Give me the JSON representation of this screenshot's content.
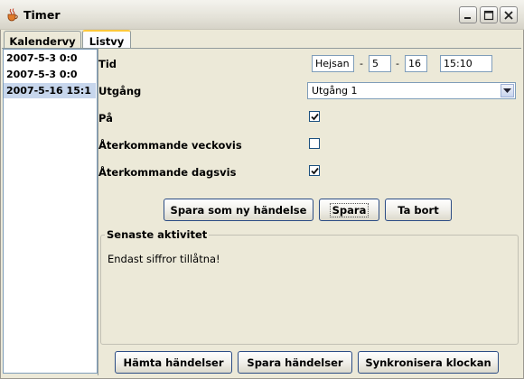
{
  "window": {
    "title": "Timer"
  },
  "tabs": [
    {
      "label": "Kalendervy",
      "active": false
    },
    {
      "label": "Listvy",
      "active": true
    }
  ],
  "event_list": {
    "items": [
      "2007-5-3 0:0",
      "2007-5-3 0:0",
      "2007-5-16 15:1"
    ],
    "selected_index": 2
  },
  "form": {
    "time": {
      "label": "Tid",
      "title_value": "Hejsan",
      "month": "5",
      "day": "16",
      "clock": "15:10",
      "separator": "-"
    },
    "output": {
      "label": "Utgång",
      "selected": "Utgång 1"
    },
    "on": {
      "label": "På",
      "checked": true
    },
    "weekly": {
      "label": "Återkommande veckovis",
      "checked": false
    },
    "daily": {
      "label": "Återkommande dagsvis",
      "checked": true
    }
  },
  "actions": {
    "save_new": "Spara som ny händelse",
    "save": "Spara",
    "delete": "Ta bort"
  },
  "activity": {
    "legend": "Senaste aktivitet",
    "message": "Endast siffror tillåtna!"
  },
  "bottom_actions": {
    "fetch": "Hämta händelser",
    "store": "Spara händelser",
    "sync": "Synkronisera klockan"
  },
  "colors": {
    "selection": "#c7d6ec",
    "tab_active_accent": "#ffc83c",
    "border": "#7f9db9",
    "window_bg": "#ece9d8"
  }
}
